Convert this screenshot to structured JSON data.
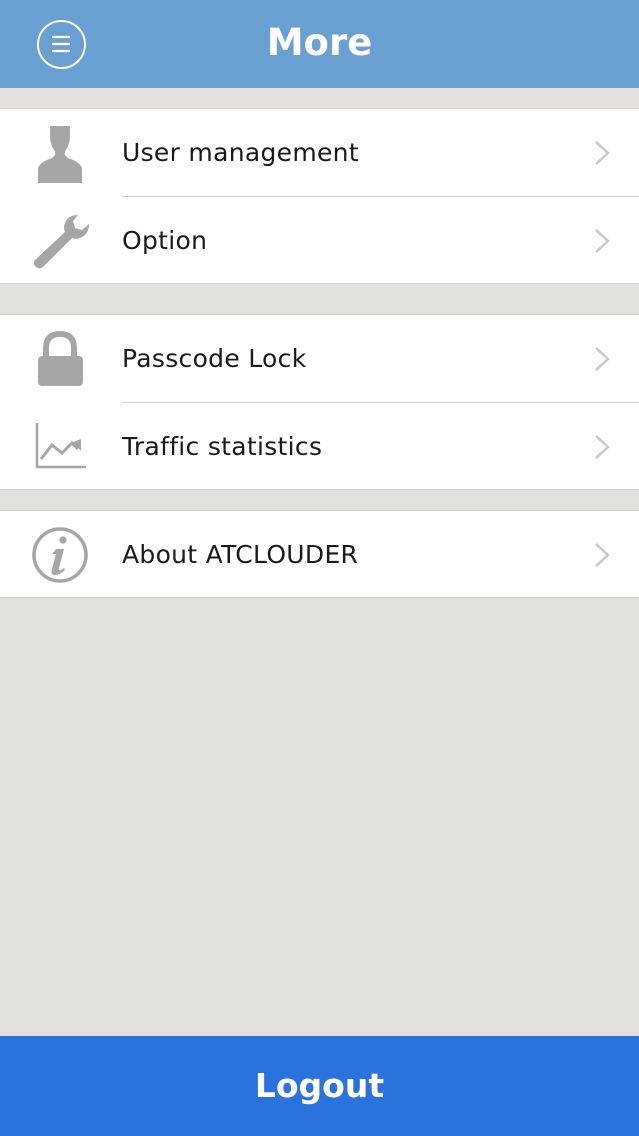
{
  "header": {
    "title": "More",
    "menu_icon": "hamburger-menu-icon"
  },
  "groups": [
    {
      "items": [
        {
          "label": "User management",
          "icon": "user-icon"
        },
        {
          "label": "Option",
          "icon": "wrench-icon"
        }
      ]
    },
    {
      "items": [
        {
          "label": "Passcode Lock",
          "icon": "lock-icon"
        },
        {
          "label": "Traffic statistics",
          "icon": "chart-icon"
        }
      ]
    },
    {
      "items": [
        {
          "label": "About ATCLOUDER",
          "icon": "info-icon"
        }
      ]
    }
  ],
  "footer": {
    "logout_label": "Logout"
  },
  "colors": {
    "header_bg": "#6a9fd1",
    "page_bg": "#e2e1dd",
    "logout_bg": "#2a73dd",
    "icon_gray": "#a6a6a6"
  }
}
